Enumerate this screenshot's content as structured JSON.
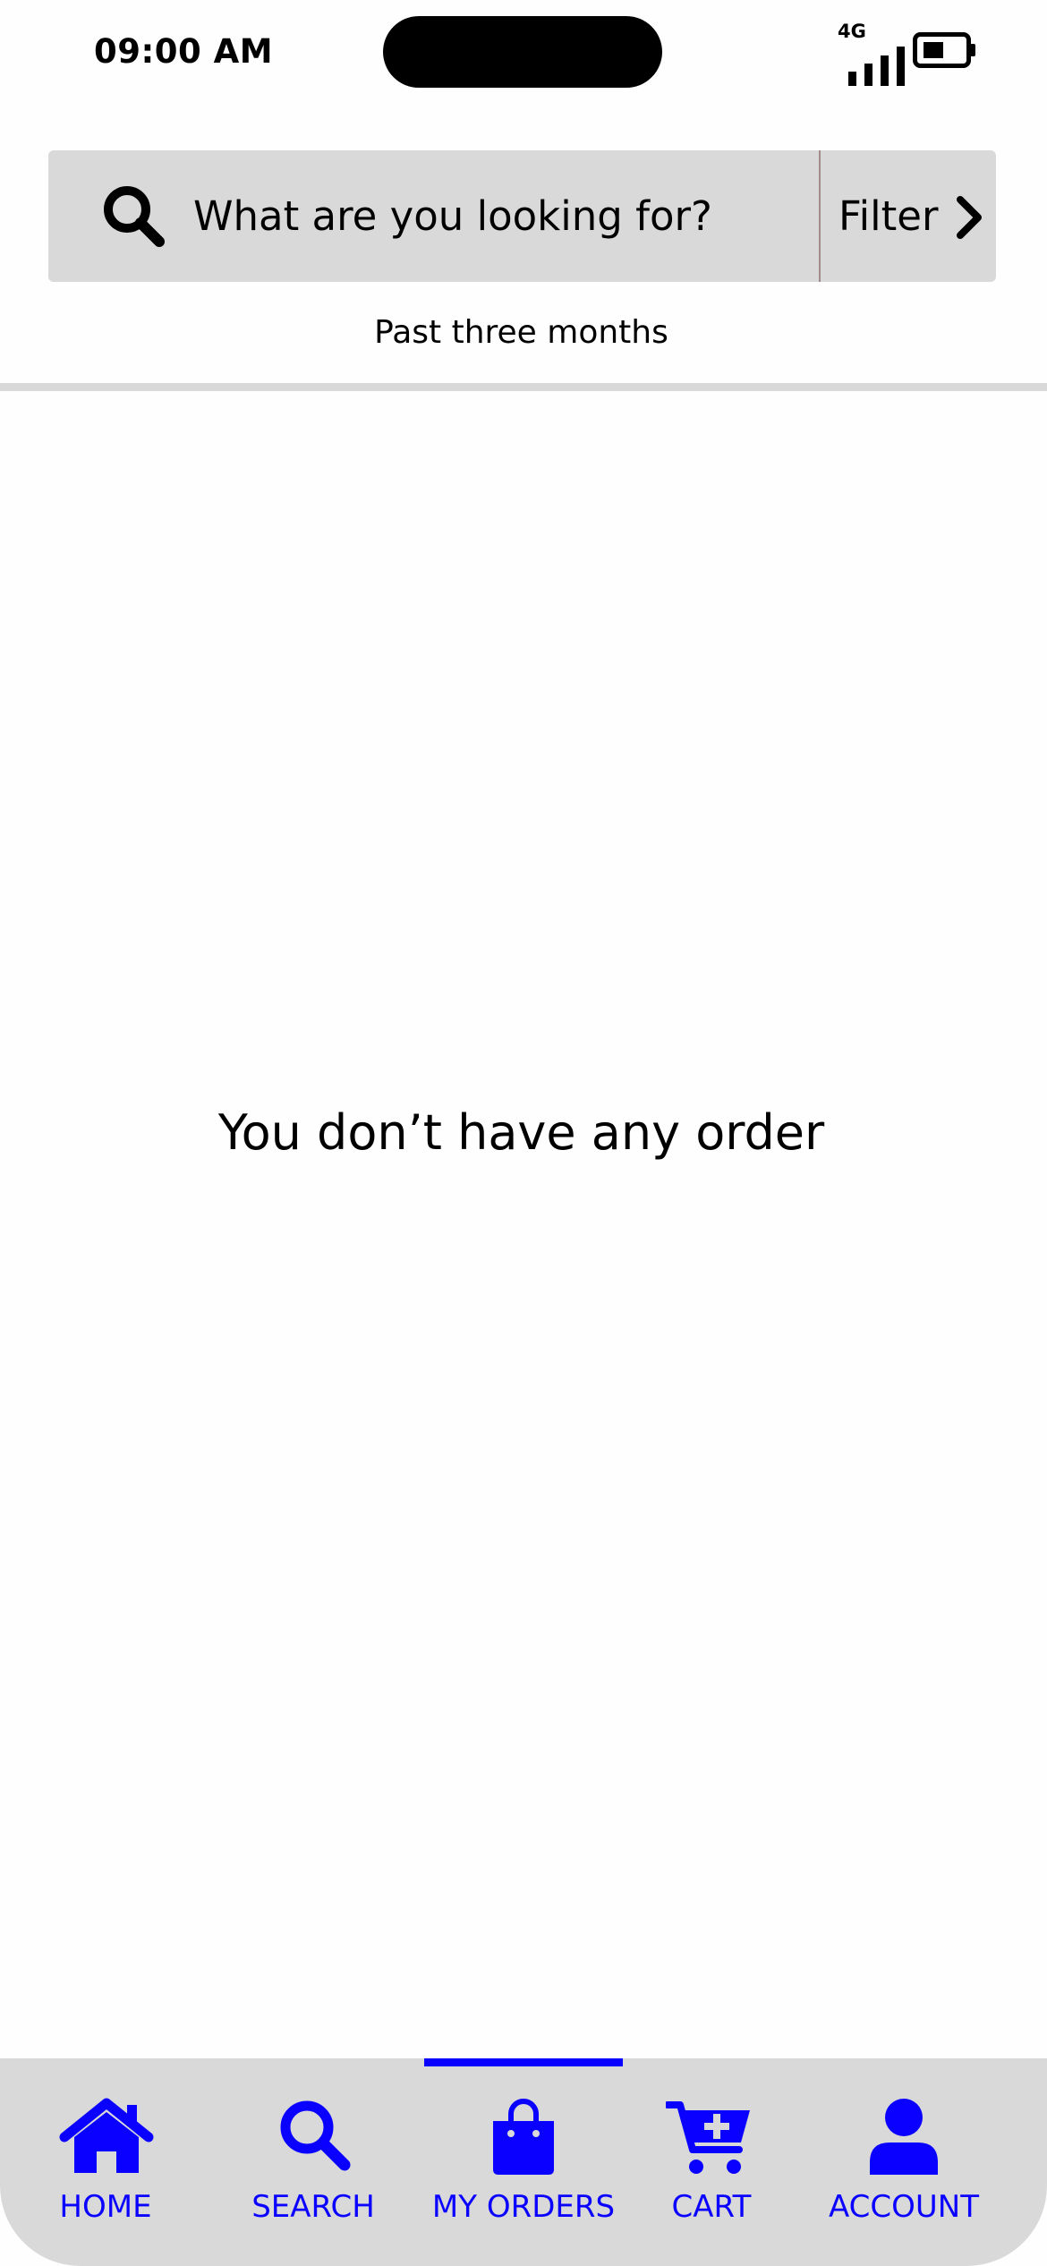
{
  "status_bar": {
    "time": "09:00 AM",
    "network": "4G"
  },
  "search": {
    "placeholder": "What are you looking for?",
    "filter_label": "Filter"
  },
  "period_label": "Past three months",
  "empty_message": "You don’t have any order",
  "bottom_nav": {
    "active": "MY ORDERS",
    "items": [
      {
        "label": "HOME",
        "icon": "home-icon"
      },
      {
        "label": "SEARCH",
        "icon": "search-icon"
      },
      {
        "label": "MY ORDERS",
        "icon": "shopping-bag-icon"
      },
      {
        "label": "CART",
        "icon": "cart-plus-icon"
      },
      {
        "label": "ACCOUNT",
        "icon": "user-icon"
      }
    ]
  },
  "colors": {
    "accent": "#0a00ff",
    "bar_background": "#d9d9d9",
    "page_background": "#fefefe"
  }
}
